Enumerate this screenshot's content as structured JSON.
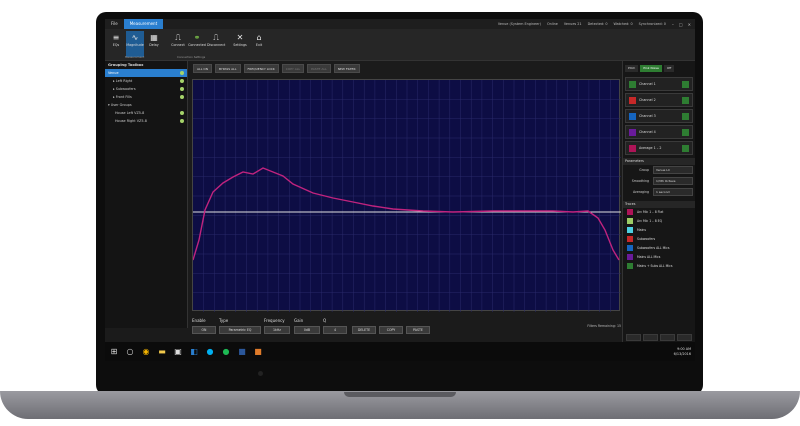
{
  "titlebar": {
    "tabs": [
      "File",
      "Measurement"
    ],
    "status": [
      "Venue (System Engineer)",
      "Online",
      "Venues 21",
      "Detected: 0",
      "Watched: 0",
      "Synchronized: 0"
    ],
    "window_buttons": [
      "–",
      "□",
      "✕"
    ]
  },
  "ribbon": {
    "buttons": [
      {
        "label": "EQs",
        "icon": "eq-icon"
      },
      {
        "label": "Magnitude",
        "icon": "magnitude-icon"
      },
      {
        "label": "Delay",
        "icon": "delay-icon"
      },
      {
        "label": "Connect",
        "icon": "connect-icon"
      },
      {
        "label": "Connected",
        "icon": "connected-icon"
      },
      {
        "label": "Disconnect",
        "icon": "disconnect-icon"
      },
      {
        "label": "Settings",
        "icon": "settings-icon"
      },
      {
        "label": "Exit",
        "icon": "exit-icon"
      }
    ],
    "groups": [
      "Measurement",
      "Connection Settings"
    ]
  },
  "left_panel": {
    "title": "Grouping Toolbox",
    "rows": [
      {
        "label": "Venue",
        "kind": "sel"
      },
      {
        "label": "Left Right",
        "kind": "child"
      },
      {
        "label": "Subwoofers",
        "kind": "child"
      },
      {
        "label": "Front Fills",
        "kind": "child"
      },
      {
        "label": "User Groups",
        "kind": "plain"
      },
      {
        "label": "House Left VZ5-8",
        "kind": "leaf"
      },
      {
        "label": "House Right VZ5-8",
        "kind": "leaf"
      }
    ]
  },
  "toolbar": {
    "buttons": [
      "ALL ON",
      "BYPASS ALL",
      "FREQUENCY LOCK",
      "COPY ALL",
      "PASTE ALL",
      "NEW FILTER"
    ]
  },
  "plot": {
    "line_color": "#c0237e",
    "zero_color": "#e0e0e0"
  },
  "bottom": {
    "labels": [
      "Enable",
      "Type",
      "Frequency",
      "Gain",
      "Q"
    ],
    "on": "ON",
    "type_value": "Parametric EQ",
    "freq_value": "1kHz",
    "gain_value": "0dB",
    "q_value": "4",
    "actions": [
      "DELETE",
      "COPY",
      "PASTE"
    ],
    "filters_remaining": "Filters Remaining: 15"
  },
  "right_panel": {
    "top_buttons": [
      "Pitch",
      "Pink Noise",
      "Off"
    ],
    "channels": [
      {
        "name": "Channel 1",
        "color": "#2e7d32"
      },
      {
        "name": "Channel 2",
        "color": "#c62828"
      },
      {
        "name": "Channel 3",
        "color": "#1565c0"
      },
      {
        "name": "Channel 4",
        "color": "#6a1b9a"
      },
      {
        "name": "Average 1 – 2",
        "color": "#ad1457"
      }
    ],
    "parameters_title": "Parameters",
    "params": [
      {
        "key": "Group",
        "value": "Venue LC"
      },
      {
        "key": "Smoothing",
        "value": "1/3th Octave"
      },
      {
        "key": "Averaging",
        "value": "1 second"
      }
    ],
    "traces_title": "Traces",
    "traces": [
      {
        "name": "Arc Mic 1 – 8 Flat",
        "color": "#ad1457"
      },
      {
        "name": "Arc Mic 1 – 8 EQ",
        "color": "#9ccc65"
      },
      {
        "name": "Mains",
        "color": "#4dd0e1"
      },
      {
        "name": "Subwoofers",
        "color": "#c62828"
      },
      {
        "name": "Subwoofers ALL Mics",
        "color": "#1565c0"
      },
      {
        "name": "Mains ALL Mics",
        "color": "#6a1b9a"
      },
      {
        "name": "Mains + Subs ALL Mics",
        "color": "#2e7d32"
      }
    ]
  },
  "taskbar": {
    "icons": [
      "windows-icon",
      "search-icon",
      "chrome-icon",
      "folder-icon",
      "app-icon",
      "outlook-icon",
      "skype-icon",
      "spotify-icon",
      "word-icon",
      "venue-icon"
    ],
    "time": "9:00 AM",
    "date": "6/13/2016"
  }
}
